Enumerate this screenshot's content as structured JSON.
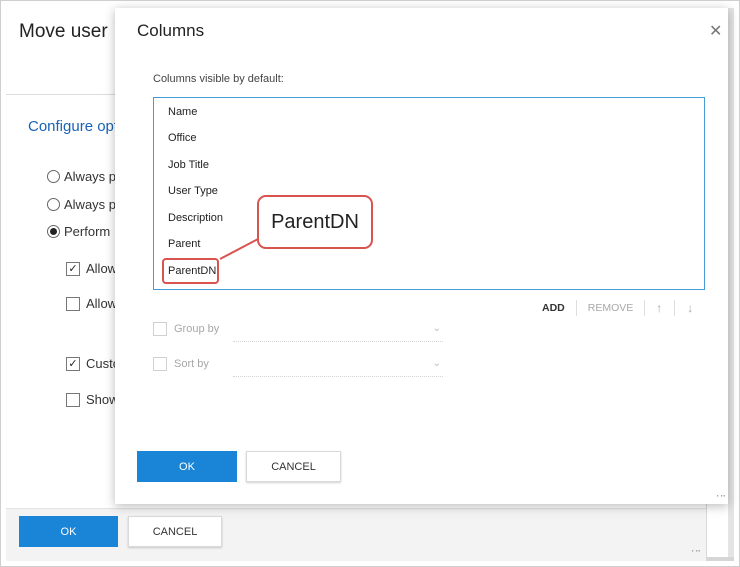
{
  "background_dialog": {
    "title": "Move user",
    "configure_label": "Configure opt",
    "radio_always_1": "Always pe",
    "radio_always_2": "Always pe",
    "radio_perform": "Perform",
    "check_allow_1": "Allow",
    "check_allow_2": "Allow",
    "check_custom": "Custo",
    "check_show": "Show",
    "ok_label": "OK",
    "cancel_label": "CANCEL"
  },
  "columns_dialog": {
    "title": "Columns",
    "close_icon": "close-icon",
    "list_label": "Columns visible by default:",
    "columns": [
      "Name",
      "Office",
      "Job Title",
      "User Type",
      "Description",
      "Parent",
      "ParentDN"
    ],
    "actions": {
      "add": "ADD",
      "remove": "REMOVE",
      "up_icon": "↑",
      "down_icon": "↓"
    },
    "group_by_label": "Group by",
    "sort_by_label": "Sort by",
    "ok_label": "OK",
    "cancel_label": "CANCEL"
  },
  "callout": {
    "text": "ParentDN",
    "color": "#d9534f"
  },
  "colors": {
    "primary": "#1a84d6",
    "link": "#1a63b5",
    "focus_border": "#4a9ad6"
  }
}
